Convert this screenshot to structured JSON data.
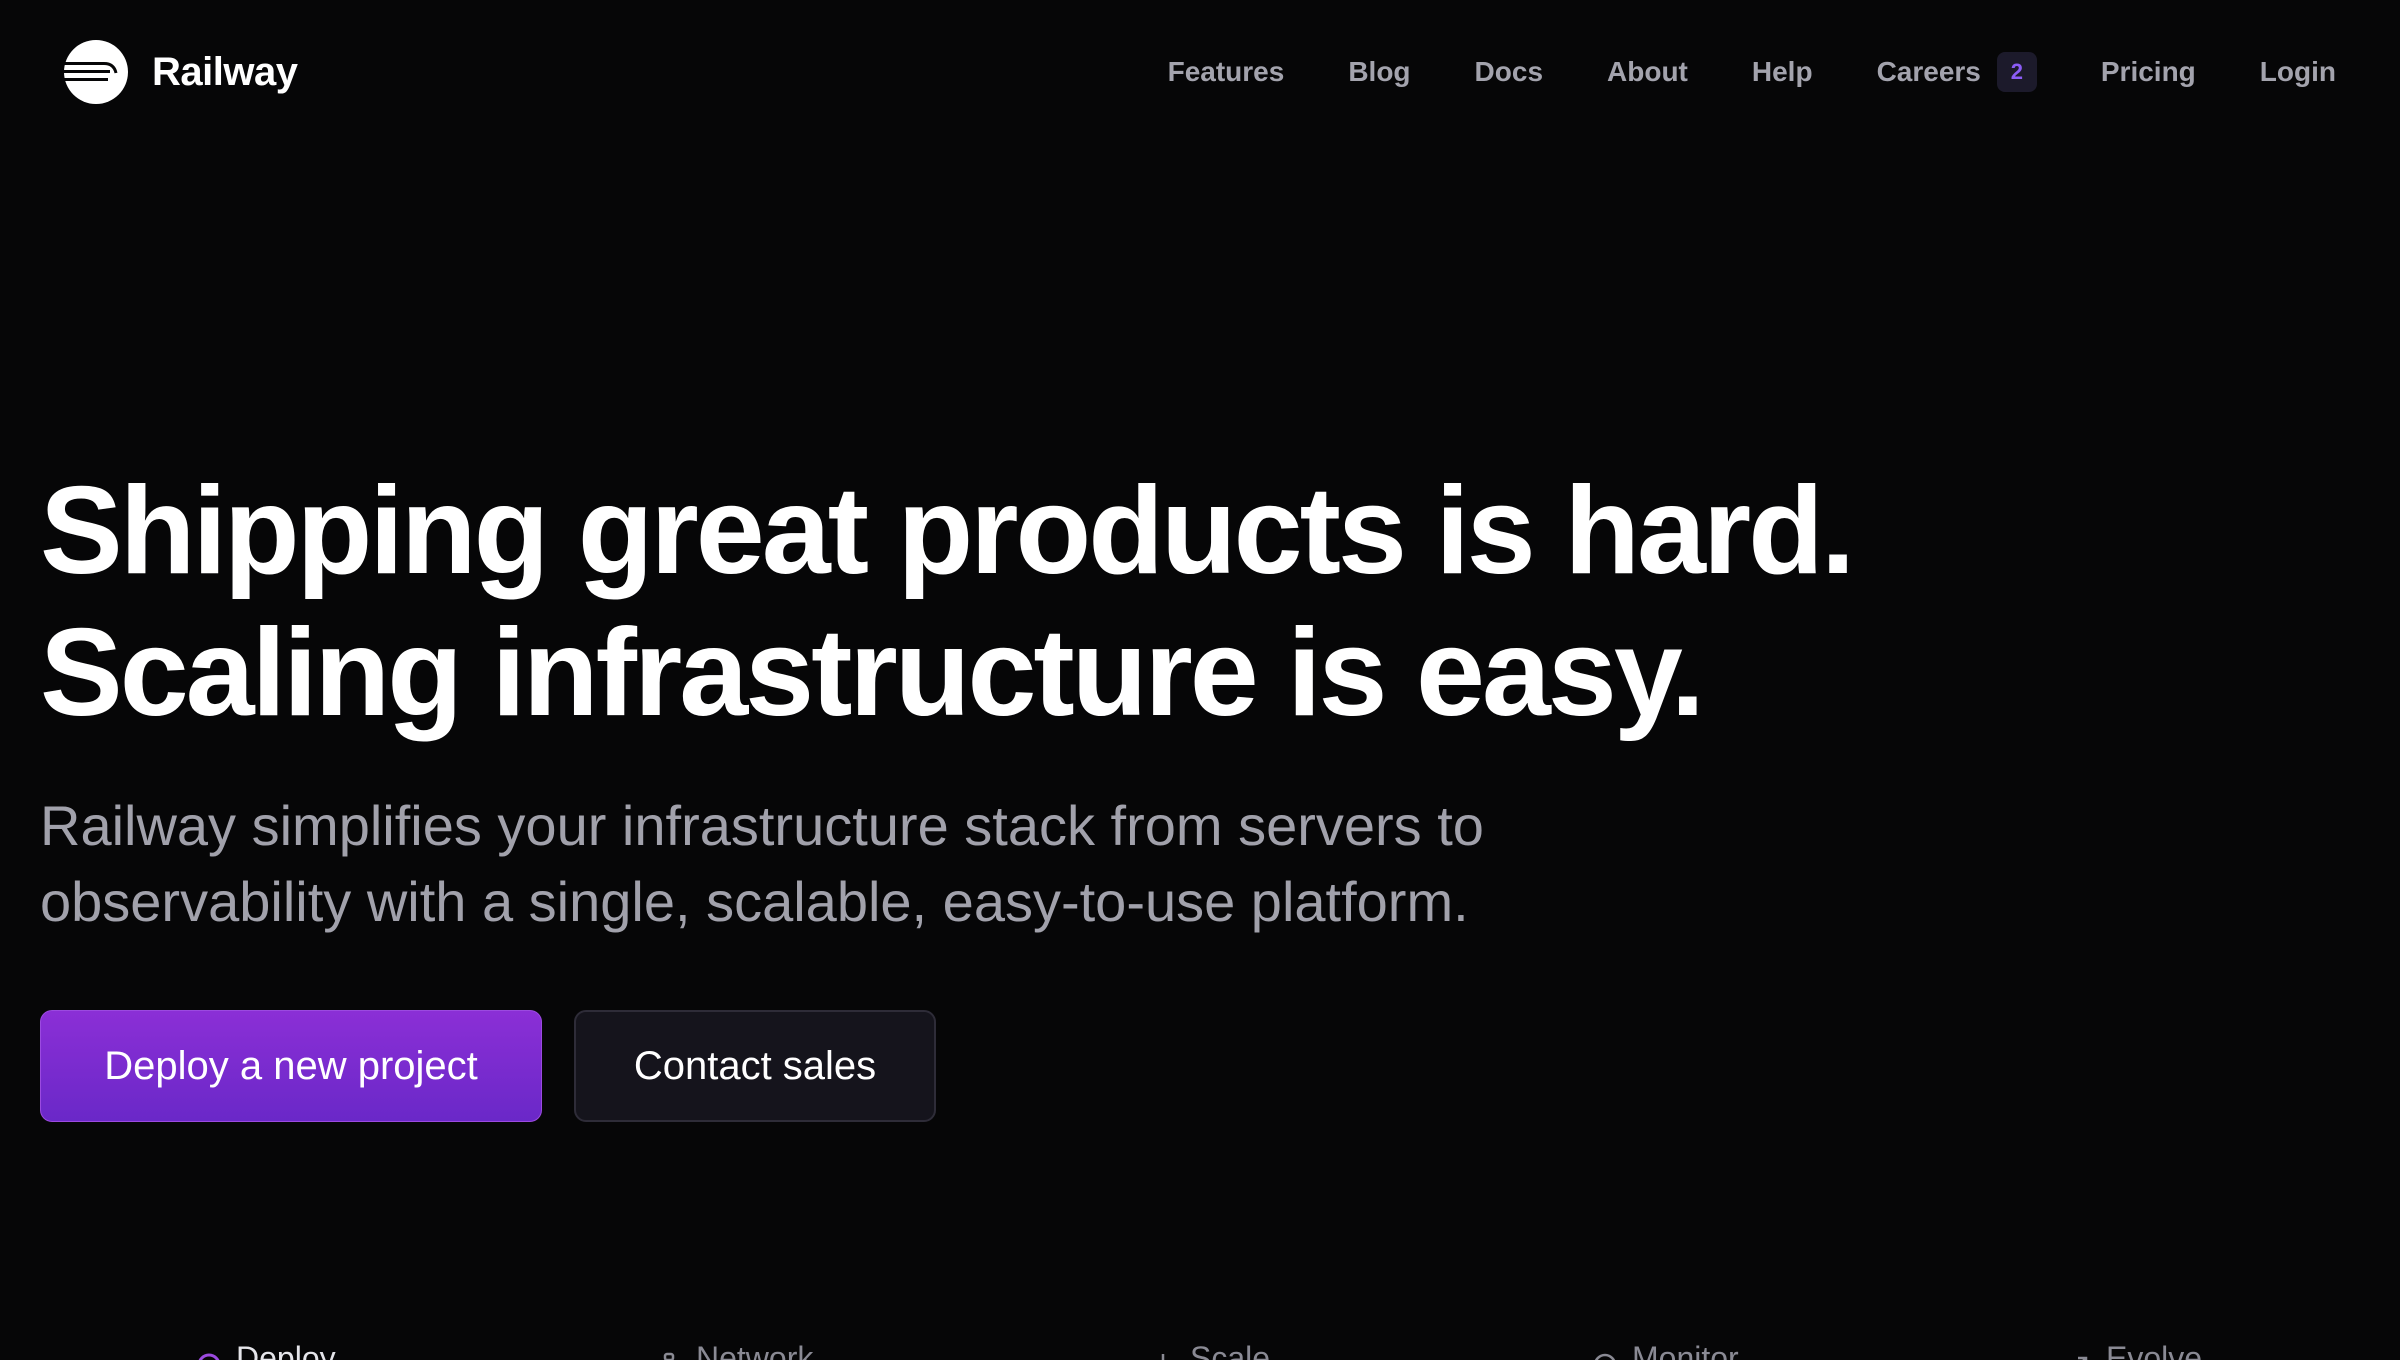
{
  "brand": {
    "name": "Railway"
  },
  "nav": {
    "items": [
      {
        "label": "Features"
      },
      {
        "label": "Blog"
      },
      {
        "label": "Docs"
      },
      {
        "label": "About"
      },
      {
        "label": "Help"
      },
      {
        "label": "Careers",
        "badge": "2"
      },
      {
        "label": "Pricing"
      },
      {
        "label": "Login"
      }
    ]
  },
  "hero": {
    "title_line1": "Shipping great products is hard.",
    "title_line2": "Scaling infrastructure is easy.",
    "subtitle": "Railway simplifies your infrastructure stack from servers to observability with a single, scalable, easy-to-use platform.",
    "primary_cta": "Deploy a new project",
    "secondary_cta": "Contact sales"
  },
  "feature_tabs": [
    {
      "label": "Deploy",
      "icon": "deploy-icon",
      "active": true
    },
    {
      "label": "Network",
      "icon": "network-icon",
      "active": false
    },
    {
      "label": "Scale",
      "icon": "scale-icon",
      "active": false
    },
    {
      "label": "Monitor",
      "icon": "monitor-icon",
      "active": false
    },
    {
      "label": "Evolve",
      "icon": "evolve-icon",
      "active": false
    }
  ],
  "colors": {
    "background": "#060607",
    "accent": "#8b5cf6",
    "primary_button": "#7a2cd0",
    "muted_text": "#a1a1ab"
  }
}
